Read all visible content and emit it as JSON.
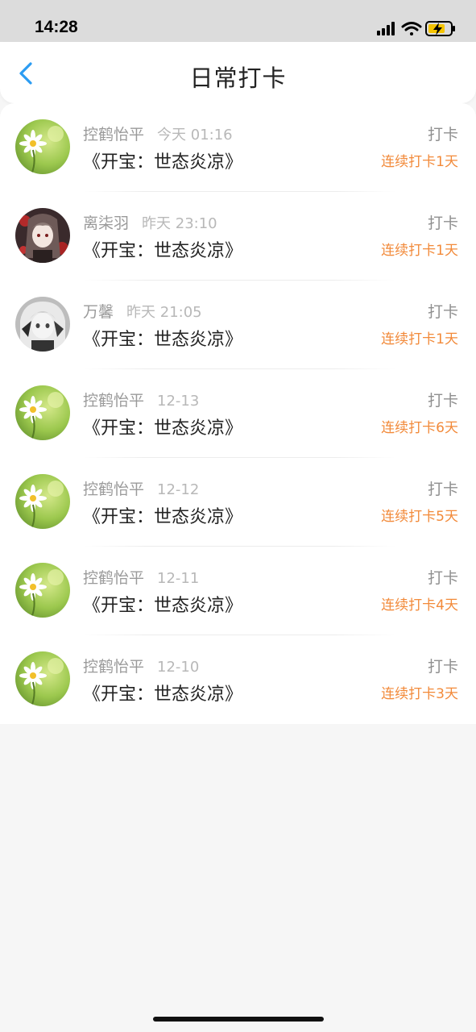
{
  "status_bar": {
    "time": "14:28",
    "icons": [
      "signal-icon",
      "wifi-icon",
      "battery-charging-icon"
    ]
  },
  "nav": {
    "back_icon": "chevron-left-icon",
    "title": "日常打卡",
    "accent": "#2b9cf2"
  },
  "colors": {
    "streak": "#f28a3a",
    "muted": "#9a9a9a"
  },
  "entries": [
    {
      "avatar": "flower",
      "user": "控鹤怡平",
      "time": "今天 01:16",
      "book": "《开宝：世态炎凉》",
      "action": "打卡",
      "streak": "连续打卡1天"
    },
    {
      "avatar": "anime-red",
      "user": "离柒羽",
      "time": "昨天 23:10",
      "book": "《开宝：世态炎凉》",
      "action": "打卡",
      "streak": "连续打卡1天"
    },
    {
      "avatar": "anime-gray",
      "user": "万馨",
      "time": "昨天 21:05",
      "book": "《开宝：世态炎凉》",
      "action": "打卡",
      "streak": "连续打卡1天"
    },
    {
      "avatar": "flower",
      "user": "控鹤怡平",
      "time": "12-13",
      "book": "《开宝：世态炎凉》",
      "action": "打卡",
      "streak": "连续打卡6天"
    },
    {
      "avatar": "flower",
      "user": "控鹤怡平",
      "time": "12-12",
      "book": "《开宝：世态炎凉》",
      "action": "打卡",
      "streak": "连续打卡5天"
    },
    {
      "avatar": "flower",
      "user": "控鹤怡平",
      "time": "12-11",
      "book": "《开宝：世态炎凉》",
      "action": "打卡",
      "streak": "连续打卡4天"
    },
    {
      "avatar": "flower",
      "user": "控鹤怡平",
      "time": "12-10",
      "book": "《开宝：世态炎凉》",
      "action": "打卡",
      "streak": "连续打卡3天"
    }
  ]
}
